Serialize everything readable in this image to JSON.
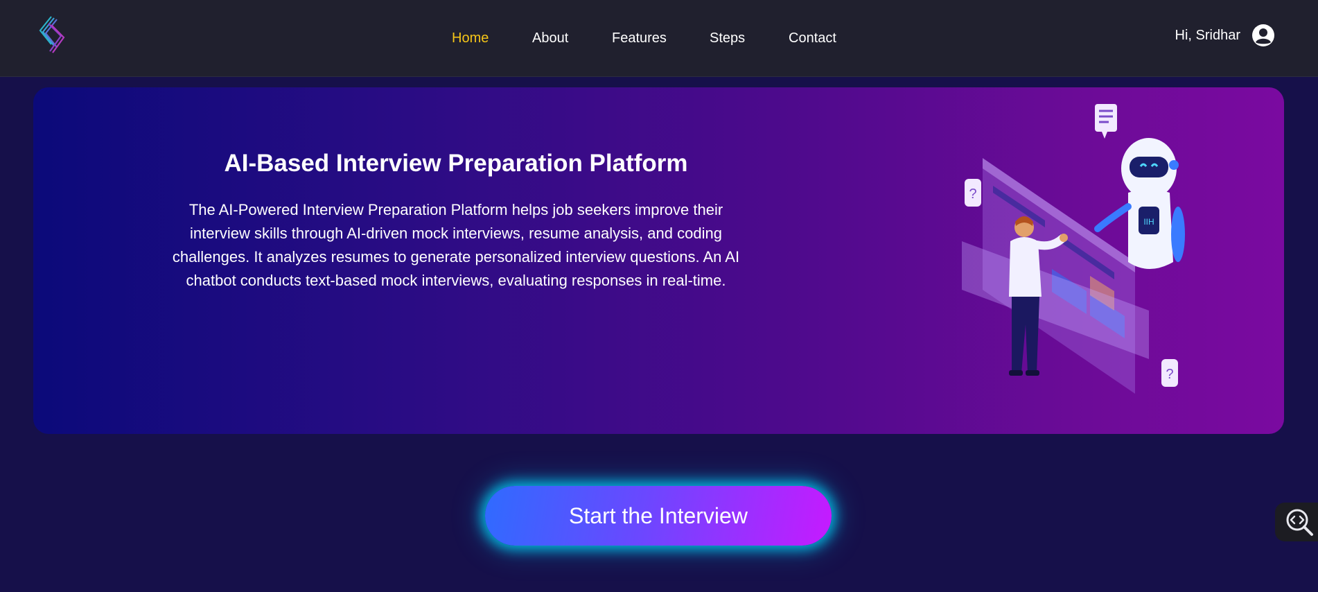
{
  "navbar": {
    "links": [
      {
        "label": "Home",
        "active": true
      },
      {
        "label": "About",
        "active": false
      },
      {
        "label": "Features",
        "active": false
      },
      {
        "label": "Steps",
        "active": false
      },
      {
        "label": "Contact",
        "active": false
      }
    ],
    "greeting": "Hi, Sridhar",
    "logo_icon": "layered-chevron-logo",
    "user_icon": "user-circle-icon"
  },
  "hero": {
    "title": "AI-Based Interview Preparation Platform",
    "description": "The AI-Powered Interview Preparation Platform helps job seekers improve their interview skills through AI-driven mock interviews, resume analysis, and coding challenges. It analyzes resumes to generate personalized interview questions. An AI chatbot conducts text-based mock interviews, evaluating responses in real-time.",
    "illustration": "person-with-robot-illustration"
  },
  "cta": {
    "label": "Start the Interview"
  },
  "floating_tool": {
    "icon": "code-search-icon"
  },
  "colors": {
    "nav_bg": "#20202e",
    "page_bg": "#16104a",
    "active_link": "#f5c518",
    "cta_glow": "#00dcff"
  }
}
